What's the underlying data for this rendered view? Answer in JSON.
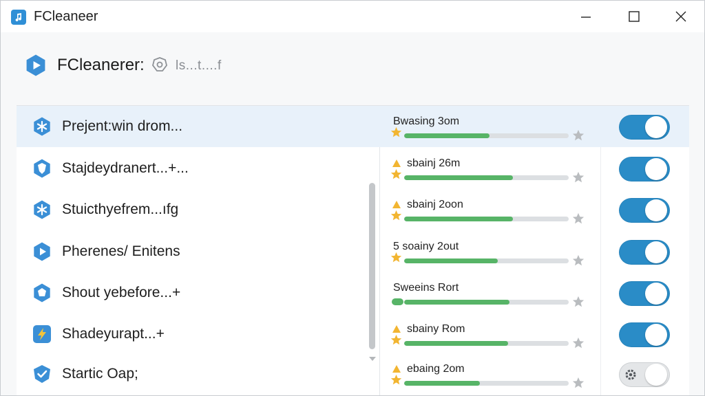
{
  "window": {
    "title": "FCleaneer"
  },
  "header": {
    "app_name": "FCleanerer:",
    "status": "ls...t....f",
    "logo_icon": "play-icon",
    "badge_icon": "gear-tag-icon"
  },
  "rows": [
    {
      "label": "Preјent:win drom...",
      "stat": "Bwasing 3om",
      "icon": "snowflake-icon",
      "progress": 0.52,
      "enabled": true,
      "selected": true
    },
    {
      "label": "Stajdeydranert...+...",
      "stat": "sbainj 26m",
      "icon": "shield-icon",
      "progress": 0.66,
      "enabled": true,
      "selected": false
    },
    {
      "label": "Stuicthyefrem...ıfg",
      "stat": "sbainj 2oon",
      "icon": "snowflake-icon",
      "progress": 0.66,
      "enabled": true,
      "selected": false
    },
    {
      "label": "Pherenes/ Enitens",
      "stat": "5 soainy 2out",
      "icon": "play-icon",
      "progress": 0.57,
      "enabled": true,
      "selected": false
    },
    {
      "label": "Shout yebefore...+",
      "stat": "Sweeins Rort",
      "icon": "badge-icon",
      "progress": 0.64,
      "enabled": true,
      "selected": false
    },
    {
      "label": "Shadeyurapt...+",
      "stat": "sbainy Rom",
      "icon": "lightning-icon",
      "progress": 0.63,
      "enabled": true,
      "selected": false
    },
    {
      "label": "Startic Oap;",
      "stat": "ebaing 2om",
      "icon": "check-badge-icon",
      "progress": 0.46,
      "enabled": false,
      "selected": false
    }
  ],
  "colors": {
    "accent": "#2a8cc7",
    "progress": "#57b467",
    "star": "#f2b531",
    "selected_row": "#e8f1fa"
  }
}
